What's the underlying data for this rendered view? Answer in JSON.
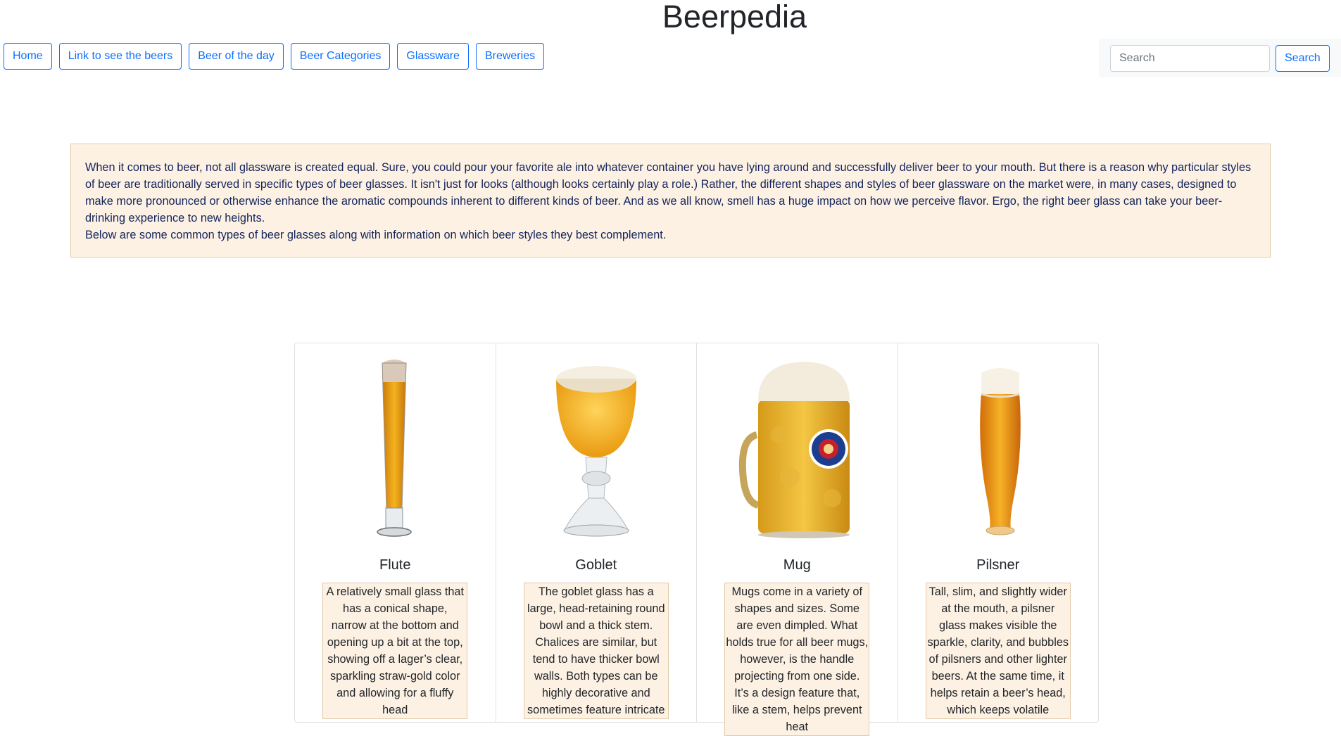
{
  "site": {
    "title": "Beerpedia"
  },
  "nav": {
    "items": [
      {
        "label": "Home"
      },
      {
        "label": "Link to see the beers"
      },
      {
        "label": "Beer of the day"
      },
      {
        "label": "Beer Categories"
      },
      {
        "label": "Glassware"
      },
      {
        "label": "Breweries"
      }
    ]
  },
  "search": {
    "placeholder": "Search",
    "button_label": "Search"
  },
  "intro": {
    "paragraph1": "When it comes to beer, not all glassware is created equal. Sure, you could pour your favorite ale into whatever container you have lying around and successfully deliver beer to your mouth. But there is a reason why particular styles of beer are traditionally served in specific types of beer glasses. It isn't just for looks (although looks certainly play a role.) Rather, the different shapes and styles of beer glassware on the market were, in many cases, designed to make more pronounced or otherwise enhance the aromatic compounds inherent to different kinds of beer. And as we all know, smell has a huge impact on how we perceive flavor. Ergo, the right beer glass can take your beer-drinking experience to new heights.",
    "paragraph2": "Below are some common types of beer glasses along with information on which beer styles they best complement."
  },
  "glasses": [
    {
      "name": "Flute",
      "icon": "flute-glass-image",
      "description": "A relatively small glass that has a conical shape, narrow at the bottom and opening up a bit at the top, showing off a lager’s clear, sparkling straw-gold color and allowing for a fluffy head"
    },
    {
      "name": "Goblet",
      "icon": "goblet-glass-image",
      "description": "The goblet glass has a large, head-retaining round bowl and a thick stem. Chalices are similar, but tend to have thicker bowl walls. Both types can be highly decorative and sometimes feature intricate"
    },
    {
      "name": "Mug",
      "icon": "mug-glass-image",
      "description": "Mugs come in a variety of shapes and sizes. Some are even dimpled. What holds true for all beer mugs, however, is the handle projecting from one side. It’s a design feature that, like a stem, helps prevent heat"
    },
    {
      "name": "Pilsner",
      "icon": "pilsner-glass-image",
      "description": "Tall, slim, and slightly wider at the mouth, a pilsner glass makes visible the sparkle, clarity, and bubbles of pilsners and other lighter beers. At the same time, it helps retain a beer’s head, which keeps volatile"
    }
  ]
}
